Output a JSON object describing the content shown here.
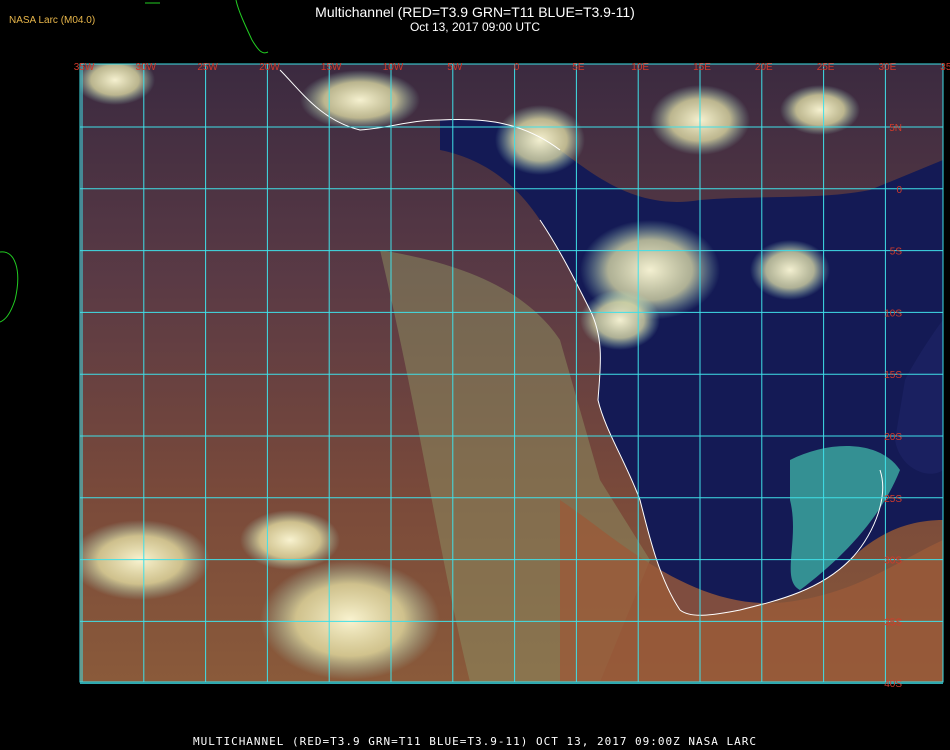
{
  "header": {
    "source_label": "NASA Larc (M04.0)",
    "title": "Multichannel (RED=T3.9 GRN=T11 BLUE=T3.9-11)",
    "datetime": "Oct 13, 2017 09:00 UTC"
  },
  "footer": {
    "caption": "MULTICHANNEL (RED=T3.9 GRN=T11 BLUE=T3.9-11) OCT 13, 2017 09:00Z    NASA LARC"
  },
  "longitude_labels": [
    "35W",
    "30W",
    "25W",
    "20W",
    "15W",
    "10W",
    "5W",
    "0",
    "5E",
    "10E",
    "15E",
    "20E",
    "25E",
    "30E",
    "35E"
  ],
  "latitude_labels": [
    "5N",
    "0",
    "5S",
    "10S",
    "15S",
    "20S",
    "25S",
    "30S",
    "35S",
    "40S"
  ],
  "colors": {
    "grid": "#3fe0e8",
    "coast": "#ffffff",
    "outer_coast": "#22cc22",
    "lat_label": "#d23a2a",
    "lon_label": "#d23a2a"
  }
}
